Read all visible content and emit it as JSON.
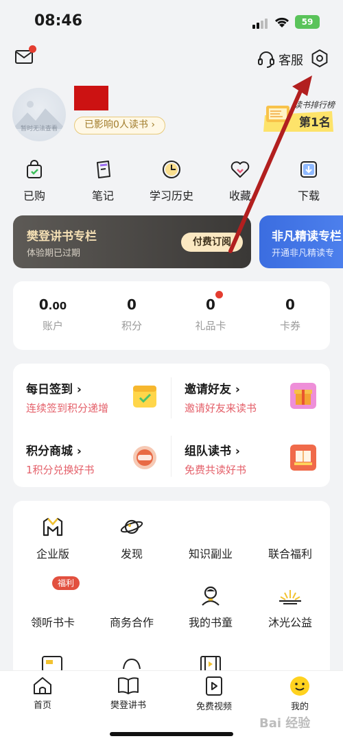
{
  "status": {
    "time": "08:46",
    "battery": "59"
  },
  "header": {
    "service_label": "客服"
  },
  "profile": {
    "avatar_caption": "暂时无法查看",
    "influence": "已影响0人读书",
    "rank_title": "读书排行榜",
    "rank_value": "第1名"
  },
  "quick_actions": [
    {
      "label": "已购",
      "icon": "bag-icon"
    },
    {
      "label": "笔记",
      "icon": "notes-icon"
    },
    {
      "label": "学习历史",
      "icon": "clock-icon"
    },
    {
      "label": "收藏",
      "icon": "heart-icon"
    },
    {
      "label": "下载",
      "icon": "download-icon"
    }
  ],
  "banners": [
    {
      "title": "樊登讲书专栏",
      "subtitle": "体验期已过期",
      "button": "付费订阅"
    },
    {
      "title": "非凡精读专栏",
      "subtitle": "开通非凡精读专"
    }
  ],
  "stats": [
    {
      "value": "0",
      "decimal": ".00",
      "label": "账户"
    },
    {
      "value": "0",
      "label": "积分"
    },
    {
      "value": "0",
      "label": "礼品卡"
    },
    {
      "value": "0",
      "label": "卡券"
    }
  ],
  "tasks": [
    {
      "title": "每日签到",
      "subtitle": "连续签到积分递增",
      "icon": "calendar-check-icon"
    },
    {
      "title": "邀请好友",
      "subtitle": "邀请好友来读书",
      "icon": "gift-box-icon"
    },
    {
      "title": "积分商城",
      "subtitle": "1积分兑换好书",
      "icon": "mall-icon"
    },
    {
      "title": "组队读书",
      "subtitle": "免费共读好书",
      "icon": "book-stack-icon"
    }
  ],
  "grid": [
    {
      "label": "企业版",
      "icon": "enterprise-icon"
    },
    {
      "label": "发现",
      "icon": "planet-icon"
    },
    {
      "label": "知识副业",
      "icon": ""
    },
    {
      "label": "联合福利",
      "icon": ""
    },
    {
      "label": "领听书卡",
      "icon": "",
      "badge": "福利"
    },
    {
      "label": "商务合作",
      "icon": ""
    },
    {
      "label": "我的书童",
      "icon": "kid-icon"
    },
    {
      "label": "沐光公益",
      "icon": "sunrise-icon"
    }
  ],
  "tabs": [
    {
      "label": "首页",
      "icon": "home-icon"
    },
    {
      "label": "樊登讲书",
      "icon": "open-book-icon"
    },
    {
      "label": "免费视频",
      "icon": "video-icon"
    },
    {
      "label": "我的",
      "icon": "smiley-icon"
    }
  ],
  "watermark": "Bai 经验",
  "colors": {
    "accent_red": "#e43d30",
    "gold": "#f4dfb4",
    "blue_banner": "#3b6de0",
    "task_subtitle": "#e4606a"
  }
}
